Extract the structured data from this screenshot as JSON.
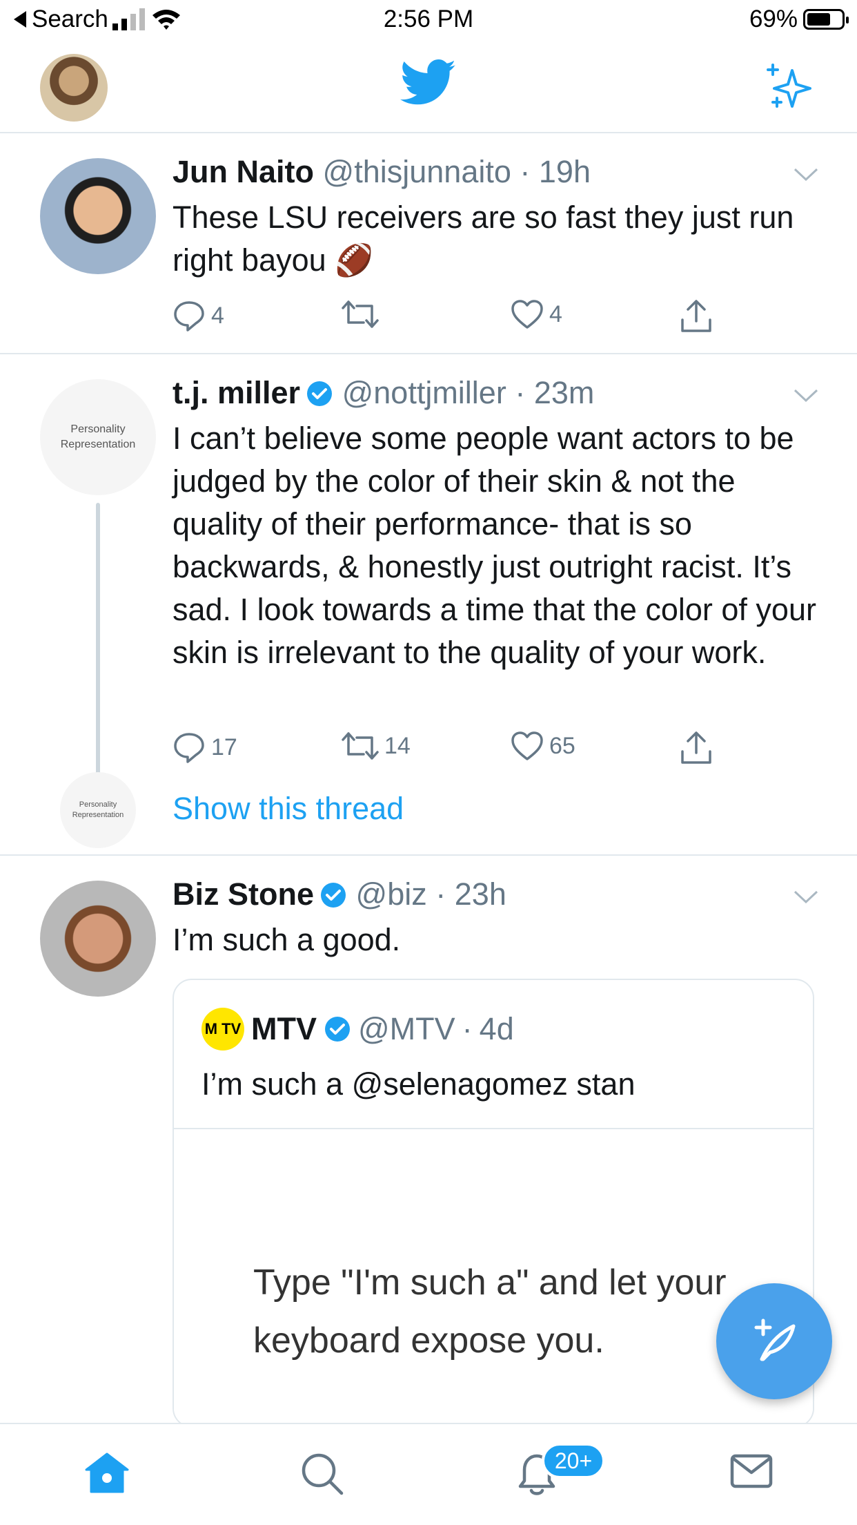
{
  "status_bar": {
    "back_label": "Search",
    "time": "2:56 PM",
    "battery": "69%",
    "battery_level": 0.69
  },
  "header": {
    "logo_icon": "twitter-bird-icon",
    "right_icon": "sparkle-icon",
    "accent_color": "#1da1f2"
  },
  "tweets": [
    {
      "name": "Jun Naito",
      "handle": "@thisjunnaito",
      "dot": "·",
      "time": "19h",
      "verified": false,
      "text": "These LSU receivers are so fast they just run right bayou 🏈",
      "replies": "4",
      "retweets": "",
      "likes": "4"
    },
    {
      "name": "t.j. miller",
      "handle": "@nottjmiller",
      "dot": "·",
      "time": "23m",
      "verified": true,
      "avatar_label": "Personality Representation",
      "text": "I can’t believe some people want actors to be judged by the color of their skin & not the quality of their performance- that is so backwards, & honestly just outright racist. It’s sad. I look towards a time that the color of your skin is irrelevant to the quality of your work.",
      "replies": "17",
      "retweets": "14",
      "likes": "65",
      "show_thread": "Show this thread",
      "thread_avatar_label": "Personality Representation"
    },
    {
      "name": "Biz Stone",
      "handle": "@biz",
      "dot": "·",
      "time": "23h",
      "verified": true,
      "text": "I’m such a good.",
      "quote": {
        "logo_text": "M TV",
        "name": "MTV",
        "handle": "@MTV",
        "dot": "·",
        "time": "4d",
        "text": "I’m such a @selenagomez stan",
        "media_line1": "Type \"I'm such a\" and let your",
        "media_line2": "keyboard expose you."
      }
    }
  ],
  "tabbar": {
    "items": [
      "home-icon",
      "search-icon",
      "notifications-icon",
      "messages-icon"
    ],
    "notifications_badge": "20+"
  }
}
